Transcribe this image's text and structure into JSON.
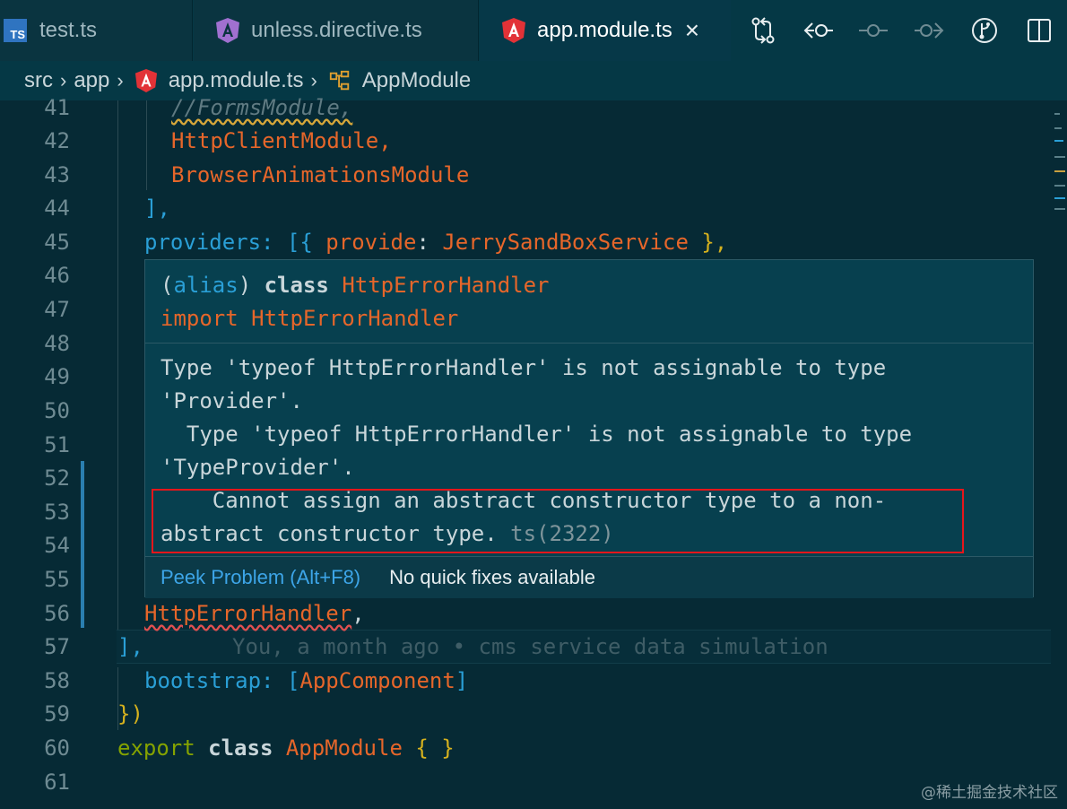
{
  "tabs": [
    {
      "label": "test.ts",
      "icon": "ts-file-icon",
      "icon_text": "TS"
    },
    {
      "label": "unless.directive.ts",
      "icon": "angular-icon"
    },
    {
      "label": "app.module.ts",
      "icon": "angular-icon",
      "active": true
    }
  ],
  "tab_close": "×",
  "breadcrumb": [
    "src",
    "app",
    "app.module.ts",
    "AppModule"
  ],
  "editor": {
    "line_numbers": [
      "41",
      "42",
      "43",
      "44",
      "45",
      "46",
      "47",
      "48",
      "49",
      "50",
      "51",
      "52",
      "53",
      "54",
      "55",
      "56",
      "57",
      "58",
      "59",
      "60",
      "61"
    ],
    "l41": "//FormsModule,",
    "l42": "HttpClientModule,",
    "l43": "BrowserAnimationsModule",
    "l44": "],",
    "l45_key": "providers",
    "l45_rest_a": ": [{ ",
    "l45_prop": "provide",
    "l45_colon": ": ",
    "l45_val": "JerrySandBoxService",
    "l45_end": " },",
    "l56": "HttpErrorHandler",
    "l56_end": ",",
    "l57": "],",
    "blame": "You, a month ago • cms service data simulation",
    "l58_key": "bootstrap",
    "l58_mid": ": [",
    "l58_val": "AppComponent",
    "l58_end": "]",
    "l59_a": "}",
    "l59_b": ")",
    "l60_kw": "export",
    "l60_cls": "class",
    "l60_name": "AppModule",
    "l60_braces": "{ }"
  },
  "hover": {
    "sig_open": "(",
    "sig_alias": "alias",
    "sig_close": ") ",
    "sig_class": "class",
    "sig_name": "HttpErrorHandler",
    "import_kw": "import",
    "import_name": "HttpErrorHandler",
    "msg1": "Type 'typeof HttpErrorHandler' is not assignable to type",
    "msg2": "'Provider'.",
    "msg3": "  Type 'typeof HttpErrorHandler' is not assignable to type",
    "msg4": "'TypeProvider'.",
    "msg5": "    Cannot assign an abstract constructor type to a non-",
    "msg6": "abstract constructor type.",
    "ts_code": "ts(2322)",
    "peek": "Peek Problem (Alt+F8)",
    "no_quick": "No quick fixes available"
  },
  "watermark": "@稀土掘金技术社区",
  "colors": {
    "accent_red": "#e5161b",
    "keyword_orange": "#e6662a",
    "link_blue": "#3da5e8"
  }
}
